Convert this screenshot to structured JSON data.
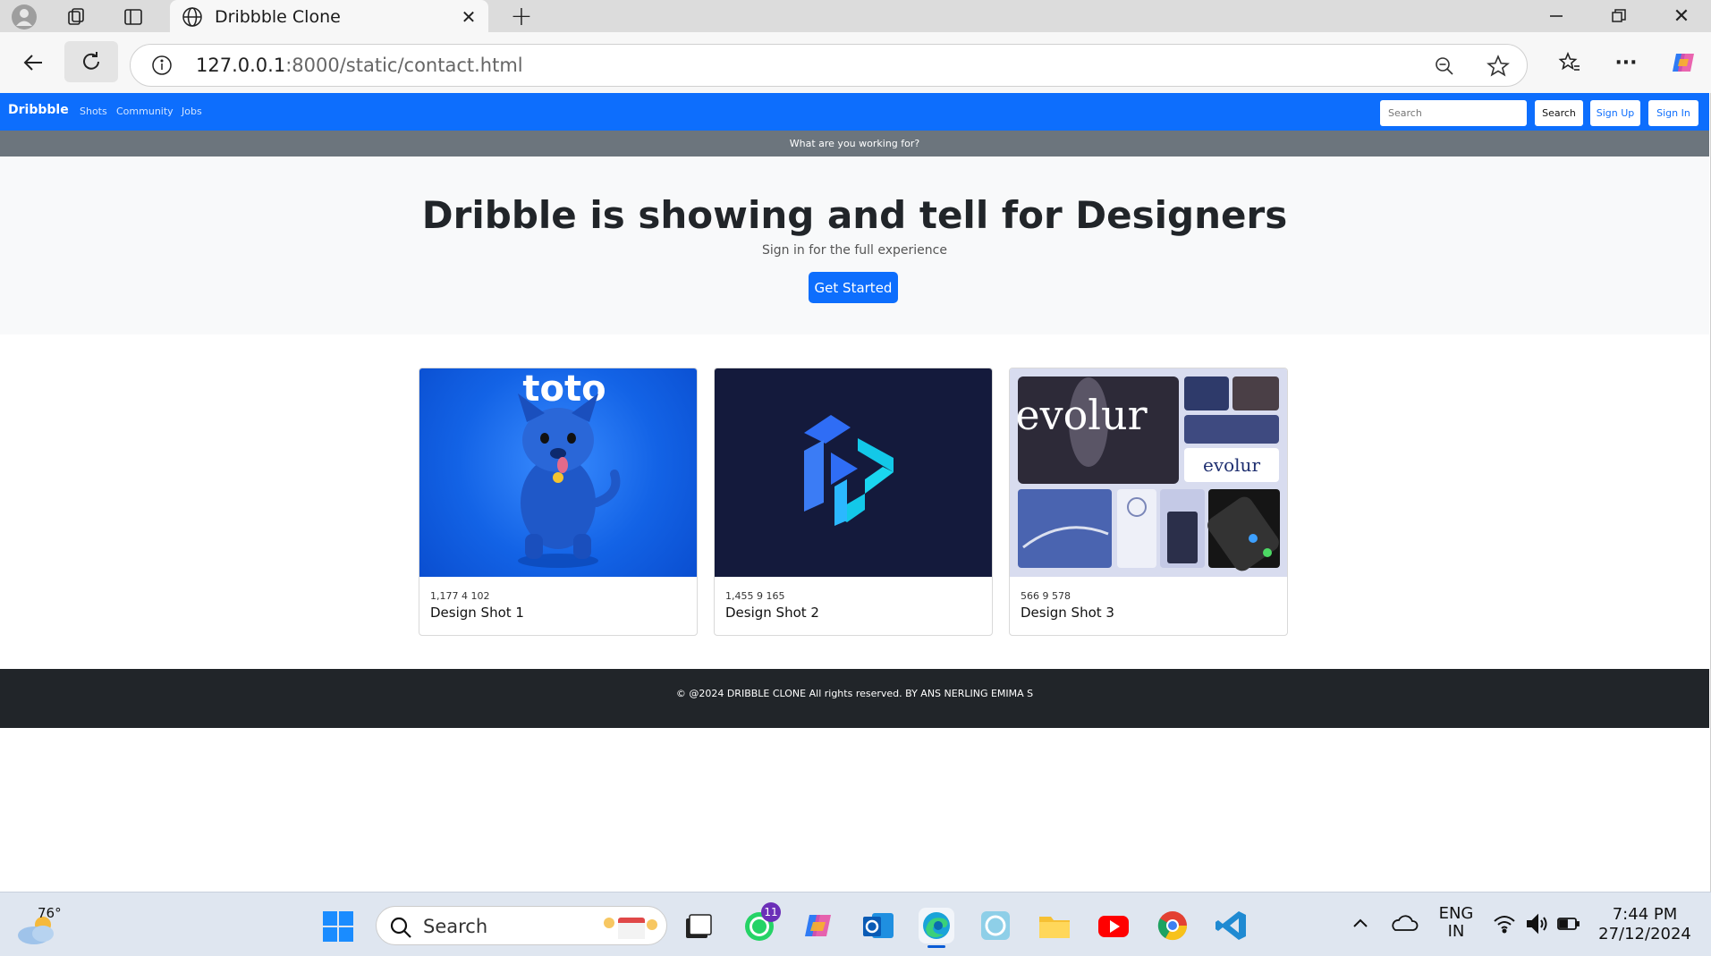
{
  "browser": {
    "tab_title": "Dribbble Clone",
    "url_host": "127.0.0.1",
    "url_rest": ":8000/static/contact.html"
  },
  "navbar": {
    "brand": "Dribbble",
    "links": [
      "Shots",
      "Community",
      "Jobs"
    ],
    "search_placeholder": "Search",
    "search_button": "Search",
    "signup_button": "Sign Up",
    "signin_button": "Sign In"
  },
  "subbar": {
    "text": "What are you working for?"
  },
  "hero": {
    "title": "Dribble is showing and tell for Designers",
    "subtitle": "Sign in for the full experience",
    "cta": "Get Started"
  },
  "cards": [
    {
      "stats": "1,177 4 102",
      "title": "Design Shot 1",
      "image_text": "toto"
    },
    {
      "stats": "1,455 9 165",
      "title": "Design Shot 2"
    },
    {
      "stats": "566 9 578",
      "title": "Design Shot 3",
      "image_text": "evolur"
    }
  ],
  "footer": {
    "text": "© @2024 DRIBBLE CLONE All rights reserved. BY ANS NERLING EMIMA S"
  },
  "taskbar": {
    "weather_temp": "76°",
    "search_label": "Search",
    "whatsapp_badge": "11",
    "lang_line1": "ENG",
    "lang_line2": "IN",
    "time": "7:44 PM",
    "date": "27/12/2024"
  },
  "colors": {
    "navbar": "#0d6efd",
    "subbar": "#6c757d",
    "hero_bg": "#f8f9fa",
    "footer": "#212529"
  }
}
